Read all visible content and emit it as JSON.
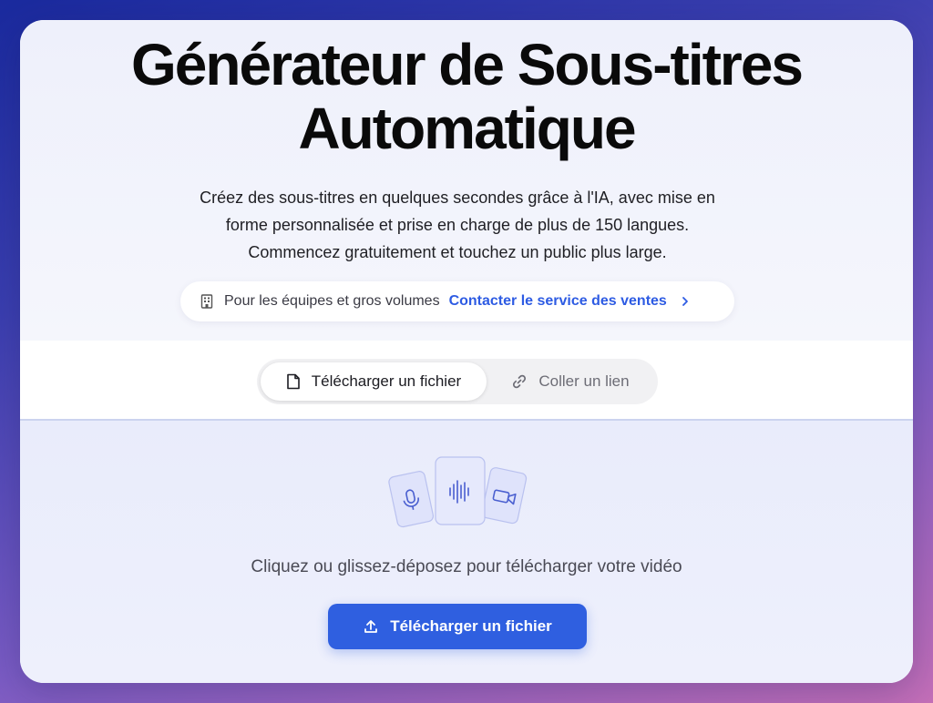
{
  "hero": {
    "title_line1": "Générateur de Sous-titres",
    "title_line2": "Automatique",
    "subtitle_line1": "Créez des sous-titres en quelques secondes grâce à l'IA, avec mise en",
    "subtitle_line2": "forme personnalisée et prise en charge de plus de 150 langues.",
    "subtitle_line3": "Commencez gratuitement et touchez un public plus large.",
    "sales_text": "Pour les équipes et gros volumes",
    "sales_link": "Contacter le service des ventes"
  },
  "tabs": [
    {
      "label": "Télécharger un fichier",
      "icon": "file-icon",
      "active": true
    },
    {
      "label": "Coller un lien",
      "icon": "link-icon",
      "active": false
    }
  ],
  "dropzone": {
    "prompt": "Cliquez ou glissez-déposez pour télécharger votre vidéo",
    "button_label": "Télécharger un fichier",
    "icons": [
      "microphone-icon",
      "audio-waveform-icon",
      "video-camera-icon"
    ]
  },
  "colors": {
    "accent": "#2f5fe0",
    "link": "#2d5be3",
    "title": "#0a0a0a"
  }
}
